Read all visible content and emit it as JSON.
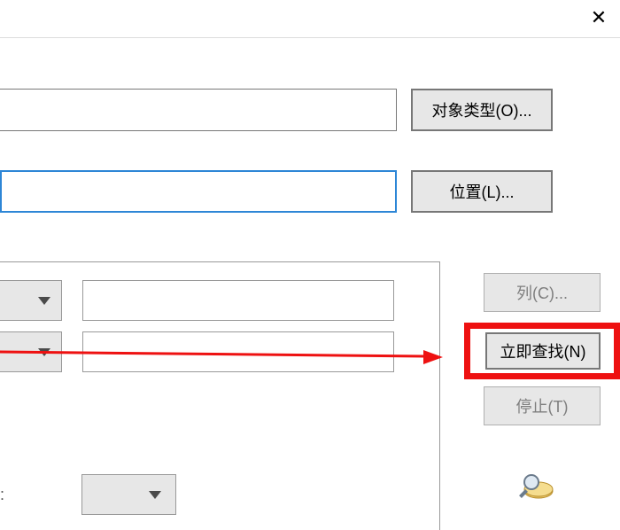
{
  "close_char": "✕",
  "top": {
    "input1_value": "",
    "input2_value": "",
    "btn_object_types": "对象类型(O)...",
    "btn_locations": "位置(L)..."
  },
  "filters": {
    "dd1_value": "",
    "dd2_value": "",
    "txt1_value": "",
    "txt2_value": ""
  },
  "right": {
    "btn_columns": "列(C)...",
    "btn_find_now": "立即查找(N)",
    "btn_stop": "停止(T)"
  },
  "dd3_value": "",
  "colon": ":"
}
